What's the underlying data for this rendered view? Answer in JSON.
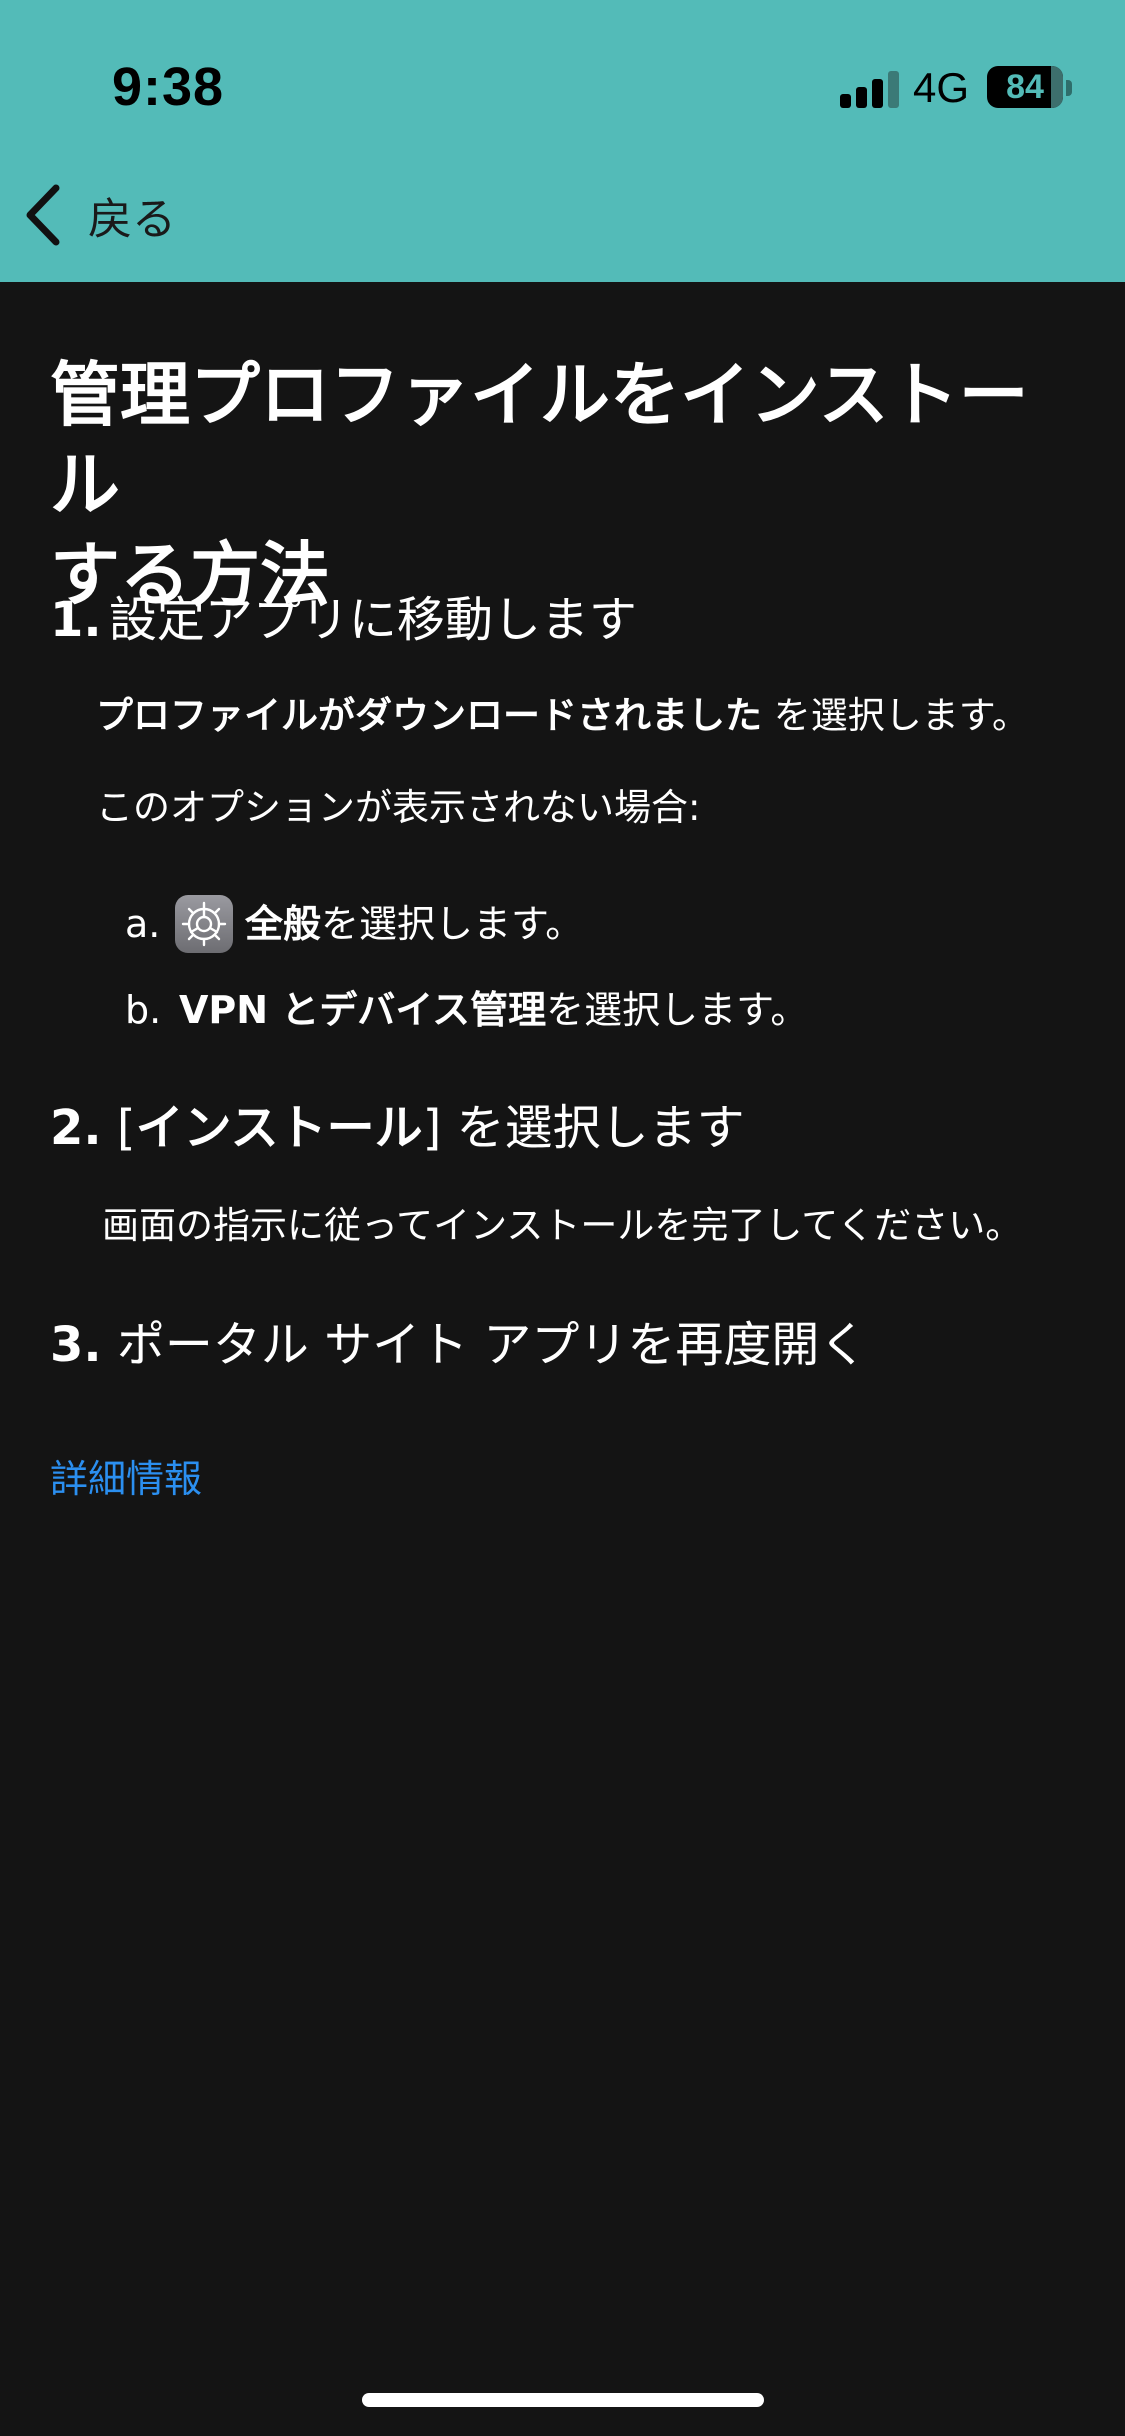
{
  "status_bar": {
    "time": "9:38",
    "network": "4G",
    "battery_level": "84",
    "battery_fraction": 0.84
  },
  "nav": {
    "back_label": "戻る",
    "back_icon": "chevron-left-icon"
  },
  "page": {
    "title_line1": "管理プロファイルをインストール",
    "title_line2": "する方法"
  },
  "steps": [
    {
      "number": "1.",
      "heading": "設定アプリに移動します",
      "instruction_bold": "プロファイルがダウンロードされました",
      "instruction_rest": " を選択します。",
      "fallback_text": "このオプションが表示されない場合:",
      "substeps": [
        {
          "marker": "a.",
          "icon": "settings-gear-icon",
          "bold": "全般",
          "rest": " を選択します。"
        },
        {
          "marker": "b.",
          "bold": "VPN とデバイス管理",
          "rest": " を選択します。"
        }
      ]
    },
    {
      "number": "2.",
      "heading_open": " [",
      "heading_bold": "インストール",
      "heading_close": "] を選択します",
      "description": "画面の指示に従ってインストールを完了してください。"
    },
    {
      "number": "3.",
      "heading": " ポータル サイト アプリを再度開く"
    }
  ],
  "more_info_link": "詳細情報",
  "colors": {
    "header_bg": "#53bbb8",
    "body_bg": "#141414",
    "link": "#2b8ff0"
  }
}
